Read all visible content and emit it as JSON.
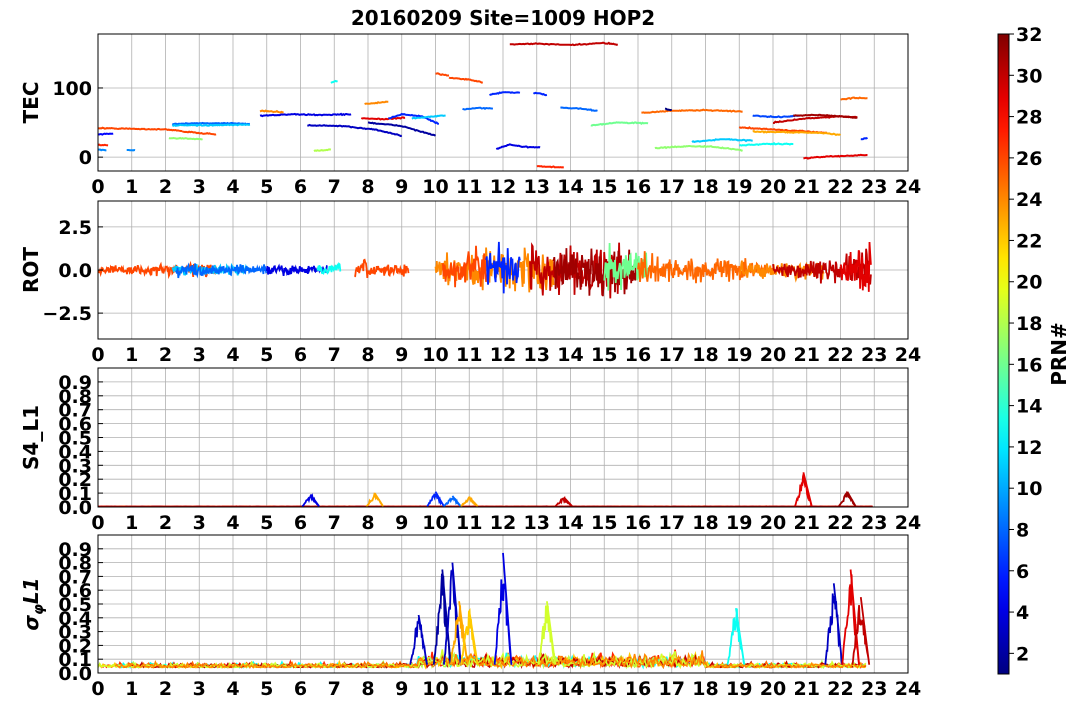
{
  "figure": {
    "title": "20160209 Site=1009 HOP2"
  },
  "chart_data": [
    {
      "type": "line",
      "panel": "TEC",
      "ylabel": "TEC",
      "xlim": [
        0,
        24
      ],
      "ylim": [
        -20,
        178
      ],
      "yticks": [
        0,
        100
      ],
      "xticks": [
        0,
        1,
        2,
        3,
        4,
        5,
        6,
        7,
        8,
        9,
        10,
        11,
        12,
        13,
        14,
        15,
        16,
        17,
        18,
        19,
        20,
        21,
        22,
        23,
        24
      ],
      "grid": true,
      "series": [
        {
          "prn": 5,
          "x": [
            0.0,
            0.45
          ],
          "values": [
            33,
            34
          ]
        },
        {
          "prn": 27,
          "x": [
            0.0,
            0.3
          ],
          "values": [
            18,
            17
          ]
        },
        {
          "prn": 26,
          "x": [
            0.0,
            1.0,
            2.0,
            2.5
          ],
          "values": [
            42,
            41,
            40,
            38
          ]
        },
        {
          "prn": 26,
          "x": [
            2.5,
            3.5
          ],
          "values": [
            37,
            33
          ]
        },
        {
          "prn": 9,
          "x": [
            0.0,
            0.25
          ],
          "values": [
            11,
            10
          ]
        },
        {
          "prn": 9,
          "x": [
            0.85,
            1.1
          ],
          "values": [
            10,
            10
          ]
        },
        {
          "prn": 17,
          "x": [
            2.1,
            2.7,
            3.1
          ],
          "values": [
            27,
            27,
            26
          ]
        },
        {
          "prn": 8,
          "x": [
            2.2,
            3.0,
            4.0,
            4.5
          ],
          "values": [
            48,
            49,
            49,
            48
          ]
        },
        {
          "prn": 11,
          "x": [
            2.2,
            3.3,
            4.5
          ],
          "values": [
            46,
            46,
            47
          ]
        },
        {
          "prn": 24,
          "x": [
            4.8,
            5.5
          ],
          "values": [
            67,
            65
          ]
        },
        {
          "prn": 4,
          "x": [
            4.8,
            5.8,
            6.5,
            7.5
          ],
          "values": [
            60,
            62,
            61,
            62
          ]
        },
        {
          "prn": 3,
          "x": [
            6.2,
            7.2,
            8.2,
            9.0
          ],
          "values": [
            46,
            45,
            40,
            31
          ]
        },
        {
          "prn": 18,
          "x": [
            6.4,
            6.9
          ],
          "values": [
            9,
            11
          ]
        },
        {
          "prn": 13,
          "x": [
            6.9,
            7.1
          ],
          "values": [
            108,
            110
          ]
        },
        {
          "prn": 24,
          "x": [
            7.9,
            8.6
          ],
          "values": [
            77,
            80
          ]
        },
        {
          "prn": 29,
          "x": [
            7.8,
            8.5,
            9.1
          ],
          "values": [
            56,
            55,
            57
          ]
        },
        {
          "prn": 6,
          "x": [
            8.6,
            9.0,
            9.6,
            10.1
          ],
          "values": [
            56,
            62,
            59,
            48
          ]
        },
        {
          "prn": 2,
          "x": [
            8.0,
            9.0,
            9.5,
            10.0
          ],
          "values": [
            50,
            45,
            38,
            31
          ]
        },
        {
          "prn": 11,
          "x": [
            9.3,
            10.0,
            10.3
          ],
          "values": [
            56,
            59,
            60
          ]
        },
        {
          "prn": 26,
          "x": [
            10.0,
            10.4
          ],
          "values": [
            121,
            118
          ]
        },
        {
          "prn": 26,
          "x": [
            10.4,
            11.0,
            11.4
          ],
          "values": [
            115,
            112,
            108
          ]
        },
        {
          "prn": 8,
          "x": [
            10.8,
            11.3,
            11.7
          ],
          "values": [
            69,
            71,
            70
          ]
        },
        {
          "prn": 6,
          "x": [
            11.6,
            12.0,
            12.5
          ],
          "values": [
            90,
            94,
            93
          ]
        },
        {
          "prn": 6,
          "x": [
            12.9,
            13.3
          ],
          "values": [
            93,
            90
          ]
        },
        {
          "prn": 4,
          "x": [
            11.8,
            12.2,
            12.6,
            13.1
          ],
          "values": [
            12,
            18,
            15,
            14
          ]
        },
        {
          "prn": 30,
          "x": [
            12.2,
            13.0,
            14.0,
            15.0,
            15.4
          ],
          "values": [
            163,
            164,
            162,
            165,
            163
          ]
        },
        {
          "prn": 27,
          "x": [
            13.0,
            13.8
          ],
          "values": [
            -13,
            -15
          ]
        },
        {
          "prn": 8,
          "x": [
            13.7,
            14.3,
            14.8
          ],
          "values": [
            72,
            70,
            67
          ]
        },
        {
          "prn": 16,
          "x": [
            14.6,
            15.4,
            16.3
          ],
          "values": [
            46,
            50,
            49
          ]
        },
        {
          "prn": 25,
          "x": [
            16.1,
            17.0,
            18.0,
            19.1
          ],
          "values": [
            64,
            67,
            68,
            66
          ]
        },
        {
          "prn": 17,
          "x": [
            16.5,
            17.5,
            18.2,
            19.1
          ],
          "values": [
            13,
            16,
            15,
            10
          ]
        },
        {
          "prn": 11,
          "x": [
            17.6,
            18.5,
            19.4
          ],
          "values": [
            22,
            26,
            24
          ]
        },
        {
          "prn": 13,
          "x": [
            19.0,
            19.8,
            20.6
          ],
          "values": [
            17,
            19,
            19
          ]
        },
        {
          "prn": 26,
          "x": [
            19.0,
            20.0,
            21.0,
            21.6
          ],
          "values": [
            43,
            40,
            37,
            35
          ]
        },
        {
          "prn": 23,
          "x": [
            19.4,
            20.5,
            21.5,
            22.0
          ],
          "values": [
            37,
            36,
            35,
            32
          ]
        },
        {
          "prn": 7,
          "x": [
            19.4,
            20.1,
            20.8
          ],
          "values": [
            60,
            58,
            60
          ]
        },
        {
          "prn": 30,
          "x": [
            20.0,
            21.0,
            22.0,
            22.5
          ],
          "values": [
            50,
            56,
            59,
            58
          ]
        },
        {
          "prn": 31,
          "x": [
            20.6,
            21.3,
            22.0,
            22.5
          ],
          "values": [
            60,
            61,
            59,
            57
          ]
        },
        {
          "prn": 29,
          "x": [
            20.9,
            21.6,
            22.2,
            22.8
          ],
          "values": [
            -2,
            1,
            2,
            3
          ]
        },
        {
          "prn": 25,
          "x": [
            22.0,
            22.4,
            22.8
          ],
          "values": [
            83,
            86,
            85
          ]
        },
        {
          "prn": 6,
          "x": [
            22.6,
            22.8
          ],
          "values": [
            26,
            28
          ]
        },
        {
          "prn": 1,
          "x": [
            16.8,
            17.0
          ],
          "values": [
            70,
            68
          ]
        }
      ]
    },
    {
      "type": "line",
      "panel": "ROT",
      "ylabel": "ROT",
      "xlim": [
        0,
        24
      ],
      "ylim": [
        -4,
        4
      ],
      "yticks": [
        -2.5,
        0.0,
        2.5
      ],
      "ytick_labels": [
        "−2.5",
        "0.0",
        "2.5"
      ],
      "xticks": [
        0,
        1,
        2,
        3,
        4,
        5,
        6,
        7,
        8,
        9,
        10,
        11,
        12,
        13,
        14,
        15,
        16,
        17,
        18,
        19,
        20,
        21,
        22,
        23,
        24
      ],
      "grid": true,
      "activity": [
        {
          "x": [
            0,
            2,
            3,
            4,
            5,
            6,
            7,
            8,
            9,
            10,
            11,
            12,
            13,
            14,
            15,
            16,
            17,
            18,
            19,
            20,
            21,
            22,
            23
          ],
          "amplitude": [
            0.4,
            0.6,
            0.6,
            0.5,
            0.6,
            0.5,
            0.5,
            1.0,
            0.6,
            1.2,
            1.8,
            2.5,
            2.2,
            2.4,
            2.5,
            2.0,
            1.2,
            1.1,
            1.0,
            0.8,
            0.9,
            1.4,
            2.6
          ]
        }
      ]
    },
    {
      "type": "line",
      "panel": "S4_L1",
      "ylabel": "S4_L1",
      "xlim": [
        0,
        24
      ],
      "ylim": [
        0.0,
        1.0
      ],
      "yticks": [
        0.0,
        0.1,
        0.2,
        0.3,
        0.4,
        0.5,
        0.6,
        0.7,
        0.8,
        0.9
      ],
      "ytick_labels": [
        "0.0",
        "0.1",
        "0.2",
        "0.3",
        "0.4",
        "0.5",
        "0.6",
        "0.7",
        "0.8",
        "0.9"
      ],
      "xticks": [
        0,
        1,
        2,
        3,
        4,
        5,
        6,
        7,
        8,
        9,
        10,
        11,
        12,
        13,
        14,
        15,
        16,
        17,
        18,
        19,
        20,
        21,
        22,
        23,
        24
      ],
      "grid": true,
      "spikes": [
        {
          "prn": 4,
          "x": 6.3,
          "value": 0.09
        },
        {
          "prn": 23,
          "x": 8.2,
          "value": 0.1
        },
        {
          "prn": 6,
          "x": 10.0,
          "value": 0.11
        },
        {
          "prn": 8,
          "x": 10.5,
          "value": 0.08
        },
        {
          "prn": 23,
          "x": 11.0,
          "value": 0.07
        },
        {
          "prn": 30,
          "x": 13.8,
          "value": 0.07
        },
        {
          "prn": 29,
          "x": 20.9,
          "value": 0.25
        },
        {
          "prn": 31,
          "x": 22.2,
          "value": 0.11
        }
      ]
    },
    {
      "type": "line",
      "panel": "sigma_phi_L1",
      "ylabel": "σφL1",
      "xlim": [
        0,
        24
      ],
      "ylim": [
        0.0,
        1.0
      ],
      "yticks": [
        0.0,
        0.1,
        0.2,
        0.3,
        0.4,
        0.5,
        0.6,
        0.7,
        0.8,
        0.9
      ],
      "ytick_labels": [
        "0.0",
        "0.1",
        "0.2",
        "0.3",
        "0.4",
        "0.5",
        "0.6",
        "0.7",
        "0.8",
        "0.9"
      ],
      "xticks": [
        0,
        1,
        2,
        3,
        4,
        5,
        6,
        7,
        8,
        9,
        10,
        11,
        12,
        13,
        14,
        15,
        16,
        17,
        18,
        19,
        20,
        21,
        22,
        23,
        24
      ],
      "grid": true,
      "spikes": [
        {
          "prn": 3,
          "x": 9.5,
          "value": 0.42
        },
        {
          "prn": 2,
          "x": 10.2,
          "value": 0.75
        },
        {
          "prn": 3,
          "x": 10.5,
          "value": 0.8
        },
        {
          "prn": 23,
          "x": 10.7,
          "value": 0.52
        },
        {
          "prn": 22,
          "x": 11.0,
          "value": 0.45
        },
        {
          "prn": 4,
          "x": 12.0,
          "value": 0.87
        },
        {
          "prn": 19,
          "x": 13.3,
          "value": 0.52
        },
        {
          "prn": 13,
          "x": 18.9,
          "value": 0.47
        },
        {
          "prn": 3,
          "x": 21.8,
          "value": 0.65
        },
        {
          "prn": 29,
          "x": 22.3,
          "value": 0.75
        },
        {
          "prn": 30,
          "x": 22.6,
          "value": 0.55
        }
      ]
    }
  ],
  "colorbar": {
    "label": "PRN#",
    "min": 1,
    "max": 32,
    "ticks": [
      2,
      4,
      6,
      8,
      10,
      12,
      14,
      16,
      18,
      20,
      22,
      24,
      26,
      28,
      30,
      32
    ]
  }
}
